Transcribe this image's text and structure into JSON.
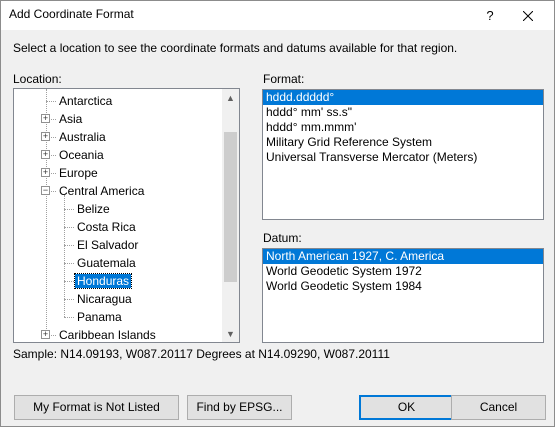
{
  "window": {
    "title": "Add Coordinate Format",
    "help_glyph": "?",
    "close_glyph": "✕"
  },
  "instruction": "Select a location to see the coordinate formats and datums available for that region.",
  "location": {
    "label": "Location:",
    "items": [
      {
        "label": "Antarctica",
        "level": 1,
        "expander": ""
      },
      {
        "label": "Asia",
        "level": 1,
        "expander": "+"
      },
      {
        "label": "Australia",
        "level": 1,
        "expander": "+"
      },
      {
        "label": "Oceania",
        "level": 1,
        "expander": "+"
      },
      {
        "label": "Europe",
        "level": 1,
        "expander": "+"
      },
      {
        "label": "Central America",
        "level": 1,
        "expander": "−"
      },
      {
        "label": "Belize",
        "level": 2,
        "expander": ""
      },
      {
        "label": "Costa Rica",
        "level": 2,
        "expander": ""
      },
      {
        "label": "El Salvador",
        "level": 2,
        "expander": ""
      },
      {
        "label": "Guatemala",
        "level": 2,
        "expander": ""
      },
      {
        "label": "Honduras",
        "level": 2,
        "expander": "",
        "selected": true
      },
      {
        "label": "Nicaragua",
        "level": 2,
        "expander": ""
      },
      {
        "label": "Panama",
        "level": 2,
        "expander": ""
      },
      {
        "label": "Caribbean Islands",
        "level": 1,
        "expander": "+"
      }
    ],
    "scroll_up_icon": "▲",
    "scroll_down_icon": "▼"
  },
  "format": {
    "label": "Format:",
    "items": [
      {
        "label": "hddd.ddddd°",
        "selected": true
      },
      {
        "label": "hddd° mm' ss.s\""
      },
      {
        "label": "hddd° mm.mmm'"
      },
      {
        "label": "Military Grid Reference System"
      },
      {
        "label": "Universal Transverse Mercator (Meters)"
      }
    ]
  },
  "datum": {
    "label": "Datum:",
    "items": [
      {
        "label": "North American 1927, C. America",
        "selected": true
      },
      {
        "label": "World Geodetic System 1972"
      },
      {
        "label": "World Geodetic System 1984"
      }
    ]
  },
  "sample": "Sample: N14.09193, W087.20117 Degrees at N14.09290, W087.20111",
  "buttons": {
    "my_format": "My Format is Not Listed",
    "find_epsg": "Find by EPSG...",
    "ok": "OK",
    "cancel": "Cancel"
  },
  "colors": {
    "selection": "#0078d7",
    "dialog_bg": "#f0f0f0"
  }
}
